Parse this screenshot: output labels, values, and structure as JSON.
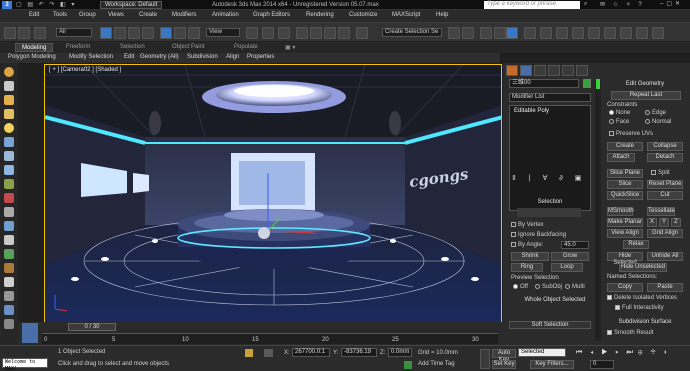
{
  "titlebar": {
    "workspace_label": "Workspace: Default",
    "window_title": "Autodesk 3ds Max  2014 x64   -  Unregistered Version     05.07.max",
    "search_placeholder": "Type a keyword or phrase"
  },
  "menubar": {
    "items": [
      "Edit",
      "Tools",
      "Group",
      "Views",
      "Create",
      "Modifiers",
      "Animation",
      "Graph Editors",
      "Rendering",
      "Customize",
      "MAXScript",
      "Help"
    ]
  },
  "toolbar": {
    "selection_filter": "All",
    "view_dropdown": "View",
    "named_selection": "Create Selection Se"
  },
  "ribbon": {
    "tabs": [
      "Modeling",
      "Freeform",
      "Selection",
      "Object Paint",
      "Populate"
    ],
    "subtabs": [
      "Polygon Modeling",
      "Modify Selection",
      "Edit",
      "Geometry (All)",
      "Subdivision",
      "Align",
      "Properties"
    ]
  },
  "viewport": {
    "label": "[ + ] [Camera02 ] [Shaded ]",
    "brand_text": "cgongs",
    "accent_color": "#f0c400"
  },
  "rightpanel": {
    "object_name": "三维00",
    "modifier_list_label": "Modifier List",
    "stack_item": "Editable Poly",
    "selection": {
      "title": "Selection",
      "by_vertex": "By Vertex",
      "ignore_backfacing": "Ignore Backfacing",
      "by_angle": "By Angle:",
      "angle_value": "45.0",
      "shrink": "Shrink",
      "grow": "Grow",
      "ring": "Ring",
      "loop": "Loop",
      "preview_selection": "Preview Selection",
      "preview_off": "Off",
      "preview_subobj": "SubObj",
      "preview_multi": "Multi",
      "status": "Whole Object Selected"
    },
    "soft_selection": "Soft Selection",
    "edit_geometry": {
      "title": "Edit Geometry",
      "repeat_last": "Repeat Last",
      "constraints": "Constraints",
      "c_none": "None",
      "c_edge": "Edge",
      "c_face": "Face",
      "c_normal": "Normal",
      "preserve_uvs": "Preserve UVs",
      "create": "Create",
      "collapse": "Collapse",
      "attach": "Attach",
      "detach": "Detach",
      "slice_plane": "Slice Plane",
      "split": "Split",
      "slice": "Slice",
      "reset_plane": "Reset Plane",
      "quickslice": "QuickSlice",
      "cut": "Cut",
      "msmooth": "MSmooth",
      "tessellate": "Tessellate",
      "make_planar": "Make Planar",
      "x": "X",
      "y": "Y",
      "z": "Z",
      "view_align": "View Align",
      "grid_align": "Grid Align",
      "relax": "Relax",
      "hide_selected": "Hide Selected",
      "unhide_all": "Unhide All",
      "hide_unselected": "Hide Unselected",
      "named_selections": "Named Selections:",
      "copy": "Copy",
      "paste": "Paste",
      "delete_isolated": "Delete Isolated Vertices",
      "full_interactivity": "Full Interactivity"
    },
    "subdivision_surface": {
      "title": "Subdivision Surface",
      "smooth_result": "Smooth Result"
    }
  },
  "trackbar": {
    "frame_counter": "0 / 30",
    "ticks": [
      "0",
      "5",
      "10",
      "15",
      "20",
      "25",
      "30"
    ]
  },
  "statusbar": {
    "maxscript_prompt": "Welcome to MAX!",
    "objects_selected": "1 Object Selected",
    "hint": "Click and drag to select and move objects",
    "x_label": "X:",
    "x_value": "267700.0:1",
    "y_label": "Y:",
    "y_value": "-83736.19",
    "z_label": "Z:",
    "z_value": "0.0mm",
    "grid": "Grid = 10.0mm",
    "add_time_tag": "Add Time Tag",
    "auto_key": "Auto Key",
    "set_key": "Set Key",
    "selected_dropdown": "Selected",
    "key_filters": "Key Filters...",
    "frame": "0"
  }
}
